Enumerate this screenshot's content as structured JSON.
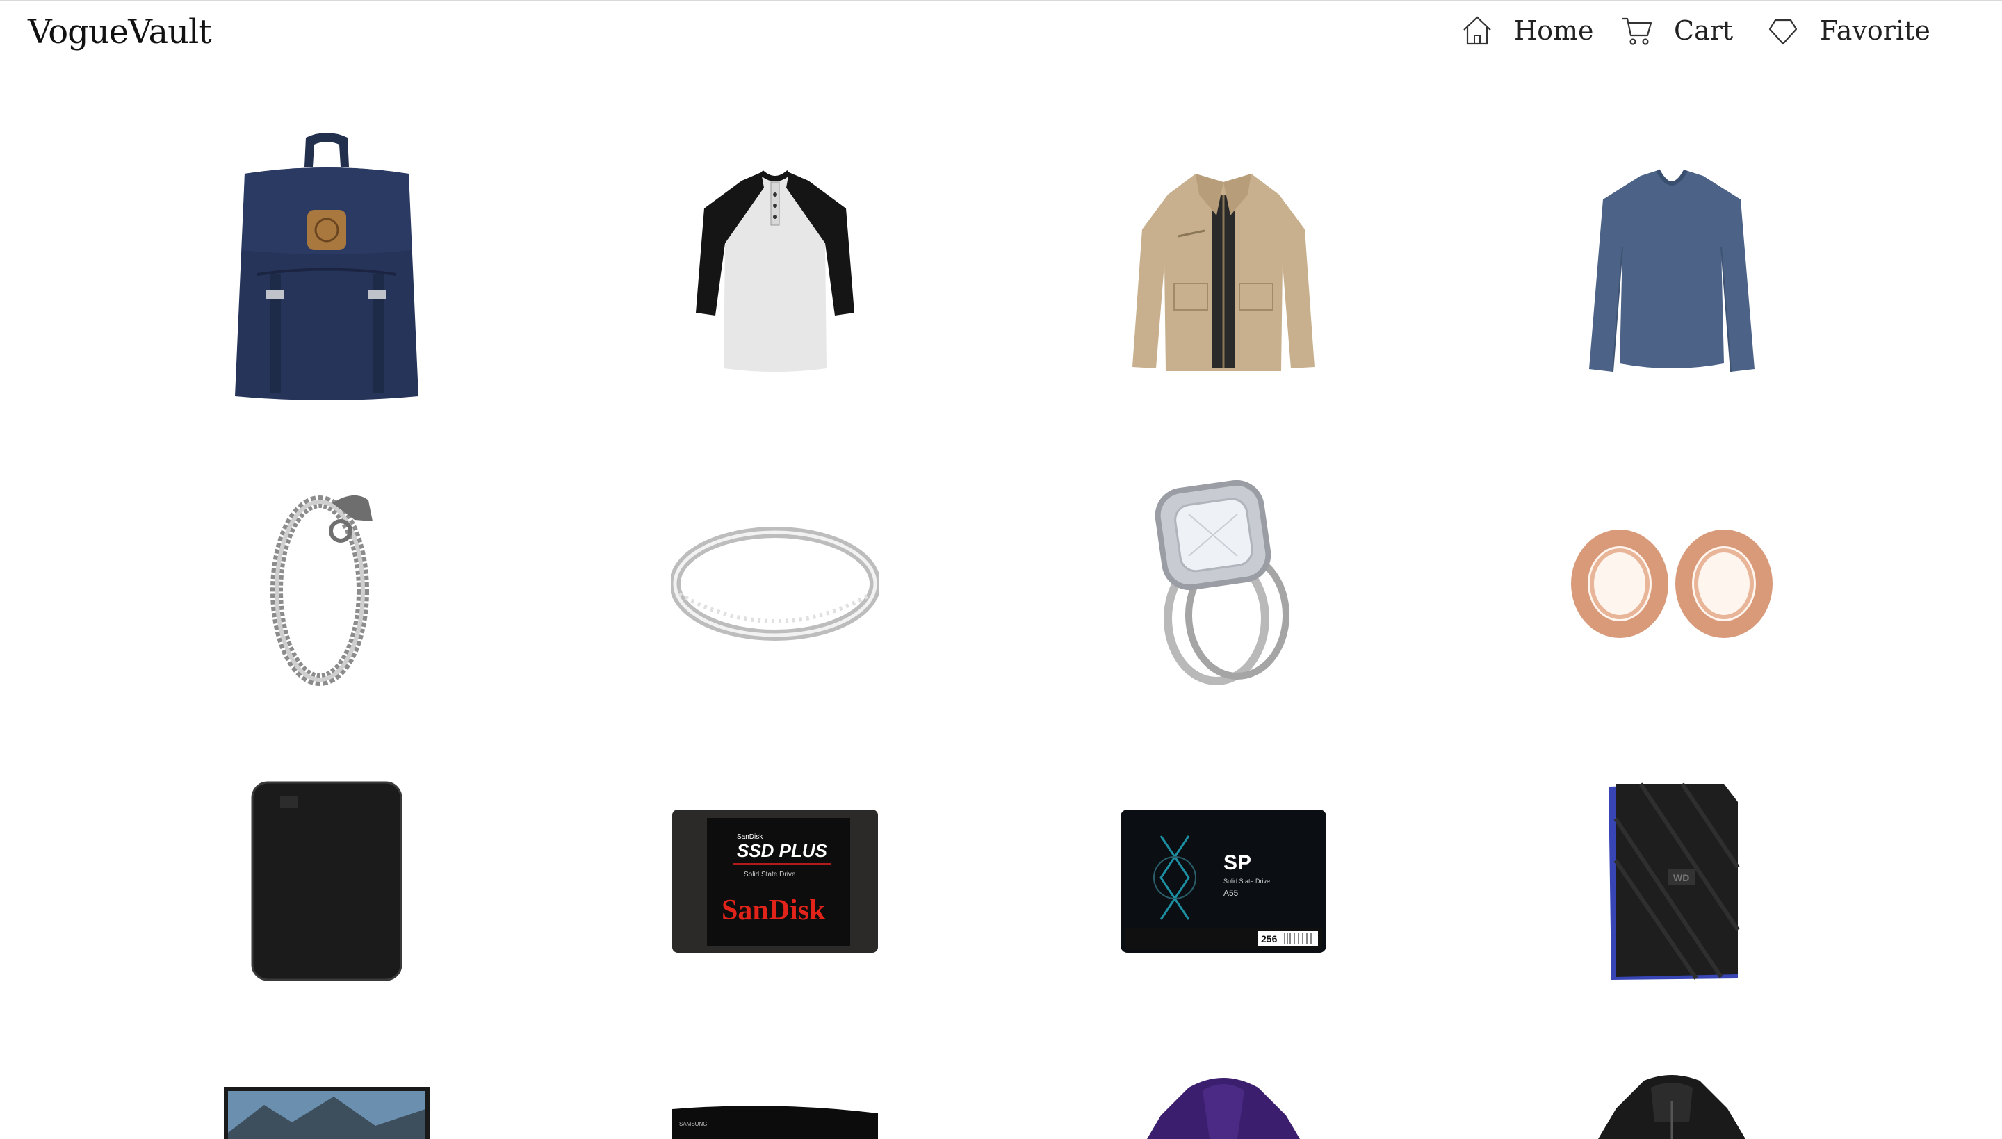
{
  "header": {
    "logo": "VogueVault"
  },
  "nav": {
    "home": "Home",
    "cart": "Cart",
    "favorite": "Favorite"
  },
  "products": [
    {
      "name": "navy backpack"
    },
    {
      "name": "raglan henley shirt"
    },
    {
      "name": "khaki field jacket"
    },
    {
      "name": "blue long sleeve shirt"
    },
    {
      "name": "dragon chain bracelet"
    },
    {
      "name": "diamond band ring"
    },
    {
      "name": "cushion halo engagement ring set"
    },
    {
      "name": "rose gold flesh tunnels"
    },
    {
      "name": "black portable hard drive"
    },
    {
      "name": "SanDisk SSD Plus",
      "brand": "SanDisk",
      "title": "SSD PLUS",
      "subtitle": "Solid State Drive",
      "mini": "SanDisk"
    },
    {
      "name": "SP A55 SSD",
      "logo": "SP",
      "subtitle": "Solid State Drive",
      "model": "A55",
      "capacity": "256"
    },
    {
      "name": "WD gaming drive",
      "logo": "WD"
    },
    {
      "name": "monitor"
    },
    {
      "name": "curved monitor",
      "brand": "SAMSUNG"
    },
    {
      "name": "purple jacket"
    },
    {
      "name": "black hoodie jacket"
    }
  ],
  "colors": {
    "navy": "#22304d",
    "khaki": "#c8b08e",
    "blue_shirt": "#4c6387",
    "rose_gold": "#d99a7a",
    "accent_blue": "#3745b5"
  }
}
